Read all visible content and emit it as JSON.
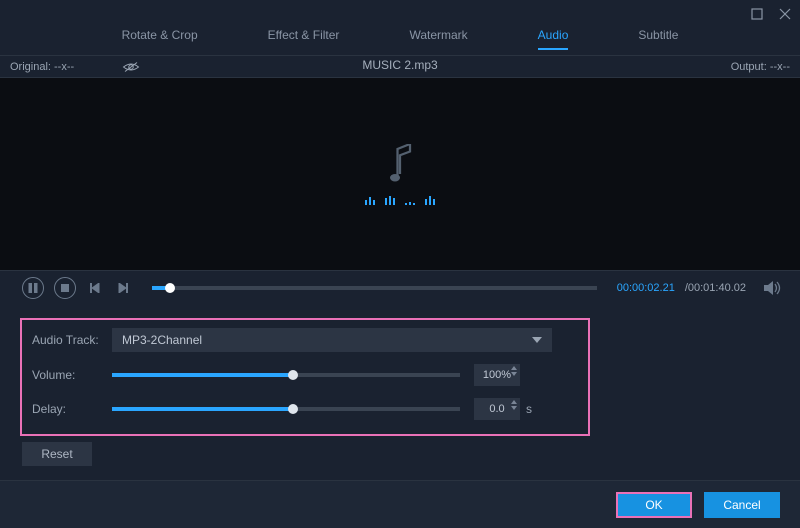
{
  "tabs": [
    "Rotate & Crop",
    "Effect & Filter",
    "Watermark",
    "Audio",
    "Subtitle"
  ],
  "active_tab": 3,
  "strip": {
    "original": "Original:  --x--",
    "output": "Output:  --x--",
    "title": "MUSIC 2.mp3"
  },
  "transport": {
    "current": "00:00:02.21",
    "total": "/00:01:40.02"
  },
  "audio": {
    "track_label": "Audio Track:",
    "track_value": "MP3-2Channel",
    "volume_label": "Volume:",
    "volume_value": "100%",
    "volume_pct": 52,
    "delay_label": "Delay:",
    "delay_value": "0.0",
    "delay_pct": 52,
    "delay_unit": "s"
  },
  "buttons": {
    "reset": "Reset",
    "ok": "OK",
    "cancel": "Cancel"
  }
}
